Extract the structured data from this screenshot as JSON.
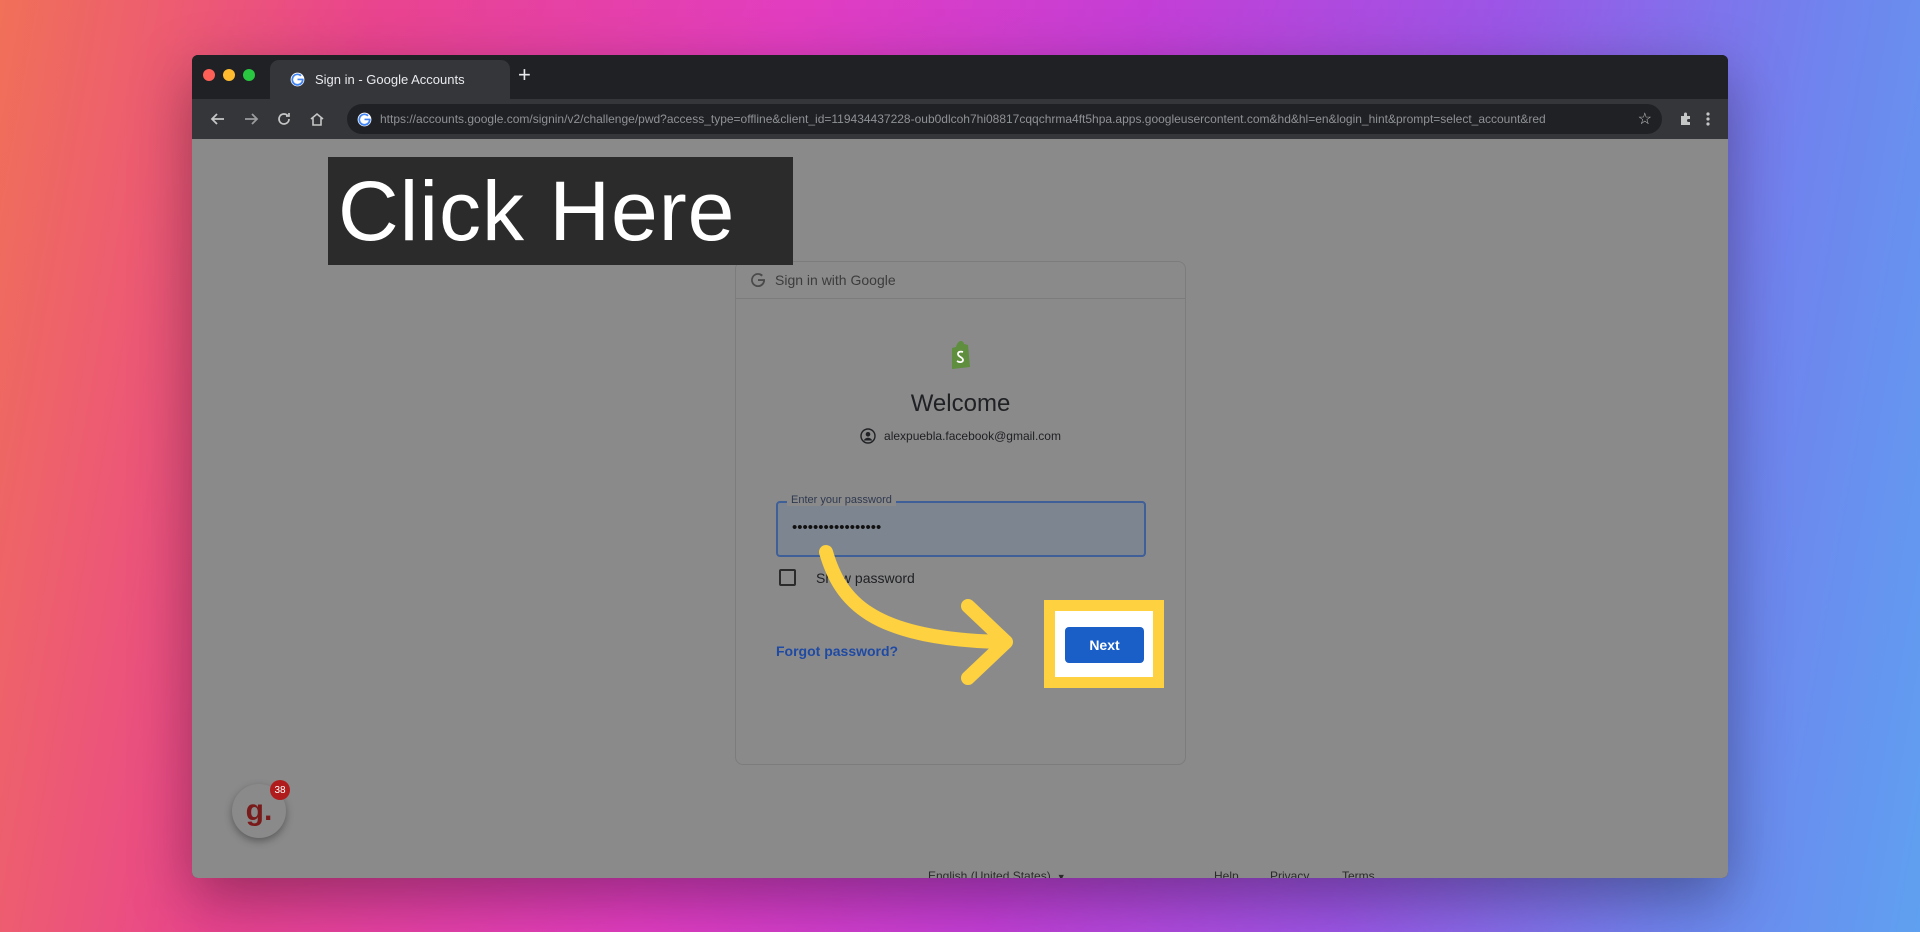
{
  "browser": {
    "tab_title": "Sign in - Google Accounts",
    "new_tab": "+",
    "url": "https://accounts.google.com/signin/v2/challenge/pwd?access_type=offline&client_id=119434437228-oub0dlcoh7hi08817cqqchrma4ft5hpa.apps.googleusercontent.com&hd&hl=en&login_hint&prompt=select_account&red"
  },
  "overlay": {
    "banner_text": "Click Here",
    "highlight_color": "#fdd13f"
  },
  "card": {
    "header": "Sign in with Google",
    "welcome": "Welcome",
    "email": "alexpuebla.facebook@gmail.com",
    "password_label": "Enter your password",
    "password_value": "•••••••••••••••••",
    "show_password": "Show password",
    "forgot": "Forgot password?",
    "next": "Next"
  },
  "footer": {
    "language": "English (United States)",
    "help": "Help",
    "privacy": "Privacy",
    "terms": "Terms"
  },
  "widget": {
    "letter": "g.",
    "badge": "38"
  },
  "colors": {
    "next_button": "#1a5fc8",
    "link": "#1f4aa3",
    "brand_green": "#5e8e3e"
  }
}
